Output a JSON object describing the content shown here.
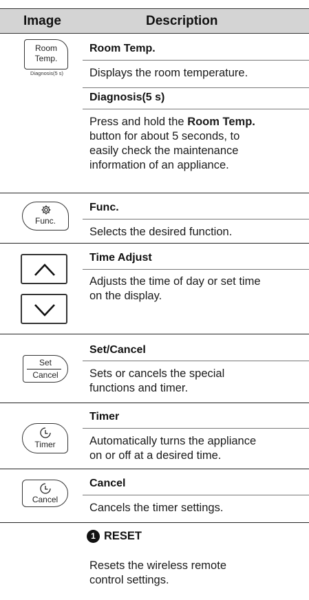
{
  "header": {
    "image": "Image",
    "description": "Description"
  },
  "rows": [
    {
      "button_top": "Room",
      "button_bottom": "Temp.",
      "button_sub": "Diagnosis(5 s)",
      "title": "Room Temp.",
      "desc": "Displays the room temperature."
    },
    {
      "title": "Diagnosis(5 s)",
      "desc_pre": "Press and hold the",
      "desc_bold": "Room Temp.",
      "desc_post_1": "button for about 5 seconds, to",
      "desc_post_2": "easily check the maintenance",
      "desc_post_3": "information of an appliance."
    },
    {
      "button_label": "Func.",
      "icon": "gear-icon",
      "title": "Func.",
      "desc": "Selects the desired function."
    },
    {
      "icons": [
        "chevron-up-icon",
        "chevron-down-icon"
      ],
      "title": "Time Adjust",
      "desc_1": "Adjusts the time of day or set time",
      "desc_2": "on the display."
    },
    {
      "button_top": "Set",
      "button_bottom": "Cancel",
      "title": "Set/Cancel",
      "desc_1": "Sets or cancels the special",
      "desc_2": "functions and timer."
    },
    {
      "button_label": "Timer",
      "icon": "clock-icon",
      "title": "Timer",
      "desc_1": "Automatically turns the appliance",
      "desc_2": "on or off at a desired time."
    },
    {
      "button_label": "Cancel",
      "icon": "clock-icon",
      "title": "Cancel",
      "desc": "Cancels the timer settings."
    },
    {
      "number": "1",
      "title": "RESET",
      "desc_1": "Resets the wireless remote",
      "desc_2": "control settings."
    }
  ]
}
